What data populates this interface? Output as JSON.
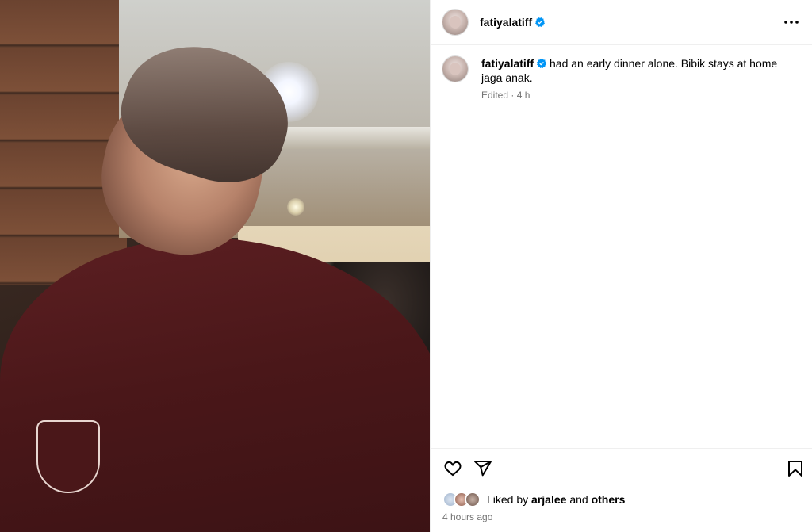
{
  "post": {
    "username": "fatiyalatiff",
    "verified": true
  },
  "caption": {
    "username": "fatiyalatiff",
    "text": "had an early dinner alone. Bibik stays at home jaga anak.",
    "meta": "Edited · 4 h"
  },
  "likes": {
    "prefix": "Liked by",
    "liker": "arjalee",
    "connector": "and",
    "others": "others"
  },
  "time_ago": "4 hours ago",
  "icons": {
    "more": "more-horizontal-icon",
    "like": "heart-icon",
    "share": "paper-plane-icon",
    "save": "bookmark-icon",
    "verified": "verified-badge-icon"
  },
  "colors": {
    "verified_blue": "#0095f6",
    "secondary_text": "#737373",
    "divider": "#efefef"
  }
}
